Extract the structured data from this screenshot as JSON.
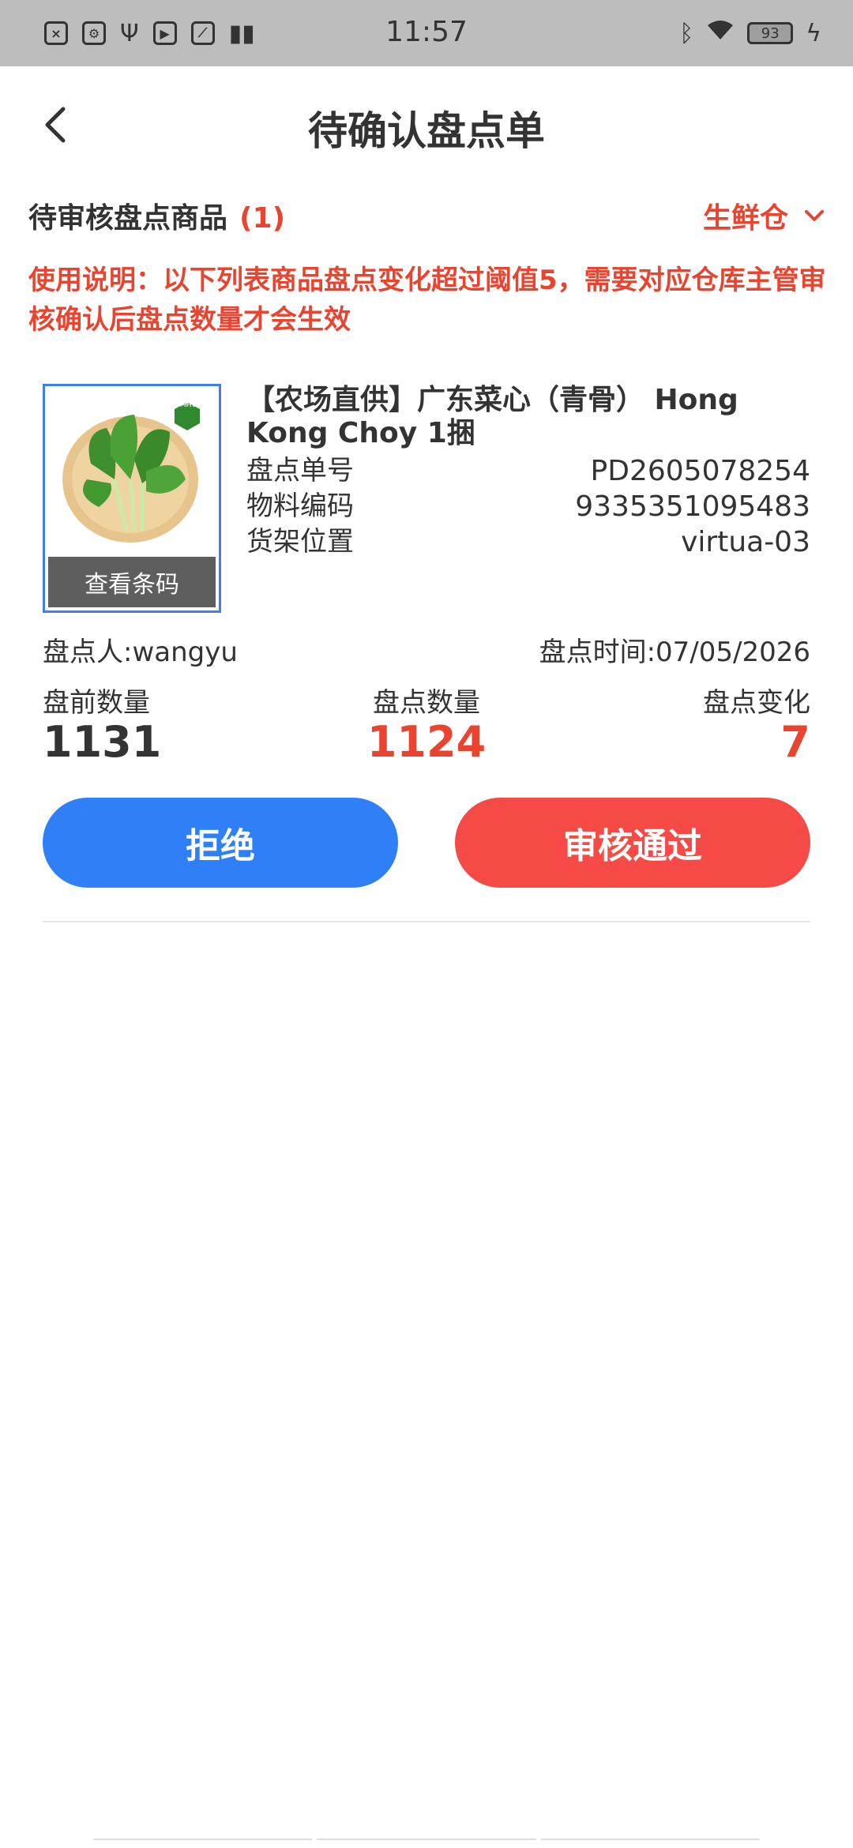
{
  "status_bar": {
    "time": "11:57",
    "battery": "93"
  },
  "nav": {
    "title": "待确认盘点单"
  },
  "section": {
    "title": "待审核盘点商品",
    "count": "(1)",
    "warehouse": "生鲜仓"
  },
  "notice": "使用说明：以下列表商品盘点变化超过阈值5，需要对应仓库主管审核确认后盘点数量才会生效",
  "item": {
    "name": "【农场直供】广东菜心（青骨） Hong Kong Choy 1捆",
    "badge": "农场特供",
    "barcode_button": "查看条码",
    "fields": [
      {
        "label": "盘点单号",
        "value": "PD2605078254"
      },
      {
        "label": "物料编码",
        "value": "9335351095483"
      },
      {
        "label": "货架位置",
        "value": "virtua-03"
      }
    ],
    "counter": "盘点人:wangyu",
    "count_time": "盘点时间:07/05/2026",
    "qty_labels": [
      "盘前数量",
      "盘点数量",
      "盘点变化"
    ],
    "qty_values": [
      "1131",
      "1124",
      "7"
    ]
  },
  "actions": {
    "reject": "拒绝",
    "approve": "审核通过"
  },
  "colors": {
    "accent_red": "#e8442f",
    "reject_blue": "#2f80f7",
    "approve_red": "#f54a45",
    "thumb_border": "#3f7fe8"
  }
}
